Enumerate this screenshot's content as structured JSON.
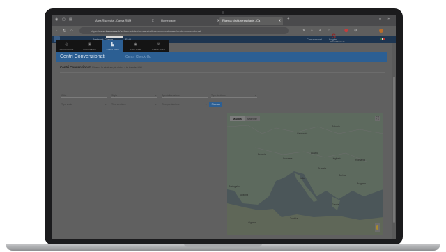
{
  "browser": {
    "tabs": [
      {
        "label": "Area Riservata - Cassa RBM",
        "active": false
      },
      {
        "label": "Home page",
        "active": false
      },
      {
        "label": "Ricerca strutture sanitarie - Ca",
        "active": true
      }
    ],
    "new_tab": "+",
    "url_host": "https://www.",
    "url_domain": "tuamutua.it",
    "url_path": "/welfaresalute/ricerca-strutture-convenzionate/centri-convenzionati",
    "win_controls": [
      "–",
      "□",
      "✕"
    ]
  },
  "site": {
    "nav": {
      "links": [
        "Network Cliente",
        "FAQ"
      ],
      "right_links": [
        "Convenzioni",
        "Log in"
      ]
    },
    "brand": {
      "logo_text": "S",
      "sub": "PREVIMEDICAL"
    },
    "tiles": [
      {
        "label": "PRESTAZIONI",
        "icon": "◎",
        "active": false
      },
      {
        "label": "DOCUMENTI",
        "icon": "▣",
        "active": false
      },
      {
        "label": "STRUTTURE",
        "icon": "▙",
        "active": true
      },
      {
        "label": "PRATICHE",
        "icon": "◉",
        "active": false
      },
      {
        "label": "ASSISTENZA",
        "icon": "✉",
        "active": false
      }
    ],
    "hero": {
      "title": "Centri Convenzionati",
      "subtitle": "Centri Check-Up"
    },
    "section": {
      "title": "Centri Convenzionati",
      "description": "Ricerca la struttura più vicina a te tramite i filtri"
    },
    "filters": {
      "row1": [
        {
          "label": "Città"
        },
        {
          "label": "Sigla"
        },
        {
          "label": "Specializzazione"
        },
        {
          "label": "Tipo struttura"
        }
      ],
      "row2": [
        {
          "label": "Tipo visita"
        },
        {
          "label": "Tipo struttura"
        },
        {
          "label": "Tipo prestazione"
        }
      ],
      "button": "Ricerca"
    },
    "map": {
      "types": [
        "Mappa",
        "Satellite"
      ],
      "active_type": "Mappa",
      "labels": [
        "Francia",
        "Germania",
        "Polonia",
        "Italia",
        "Spagna",
        "Portogallo",
        "Austria",
        "Croazia",
        "Serbia",
        "Romania",
        "Ungheria",
        "Svizzera",
        "Grecia",
        "Tunisia",
        "Algeria",
        "Bulgaria"
      ]
    }
  }
}
